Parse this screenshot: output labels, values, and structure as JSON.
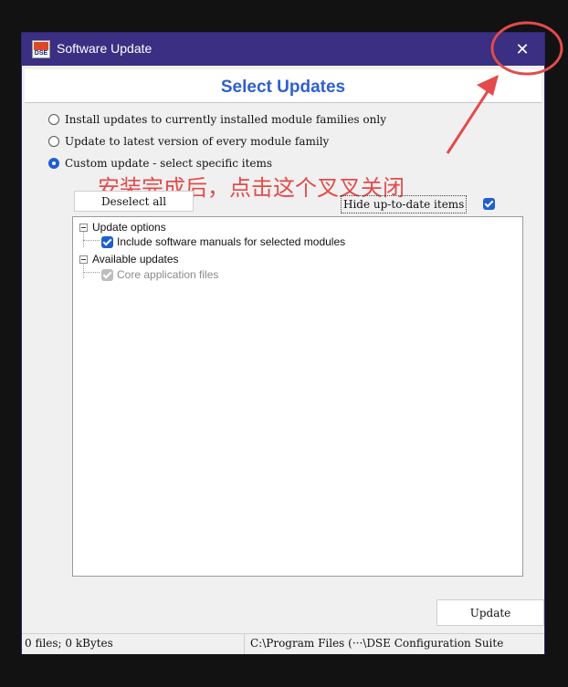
{
  "window": {
    "title": "Software Update",
    "icon_label": "DSE",
    "close_glyph": "✕"
  },
  "heading": "Select Updates",
  "options": [
    {
      "label": "Install updates to currently installed module families only",
      "selected": false
    },
    {
      "label": "Update to latest version of every module family",
      "selected": false
    },
    {
      "label": "Custom update - select specific items",
      "selected": true
    }
  ],
  "controls": {
    "deselect_all": "Deselect all",
    "hide_up_to_date": "Hide up-to-date items",
    "hide_up_to_date_checked": true
  },
  "tree": {
    "groups": [
      {
        "label": "Update options",
        "items": [
          {
            "label": "Include software manuals for selected modules",
            "checked": true,
            "disabled": false
          }
        ]
      },
      {
        "label": "Available updates",
        "items": [
          {
            "label": "Core application files",
            "checked": true,
            "disabled": true
          }
        ]
      }
    ]
  },
  "annotation": {
    "text": "安装完成后，点击这个叉叉关闭",
    "color": "#e34b4b"
  },
  "footer": {
    "update_button": "Update",
    "status_left": "0 files; 0 kBytes",
    "status_right": "C:\\Program Files (···\\DSE Configuration Suite"
  },
  "colors": {
    "titlebar": "#3a2f82",
    "accent": "#1f5fd0",
    "heading": "#2f5fd0"
  },
  "icons": {
    "app": "dse-app-icon",
    "close": "close-icon",
    "checkbox": "checkbox-checked-icon",
    "expander": "tree-collapse-icon"
  }
}
